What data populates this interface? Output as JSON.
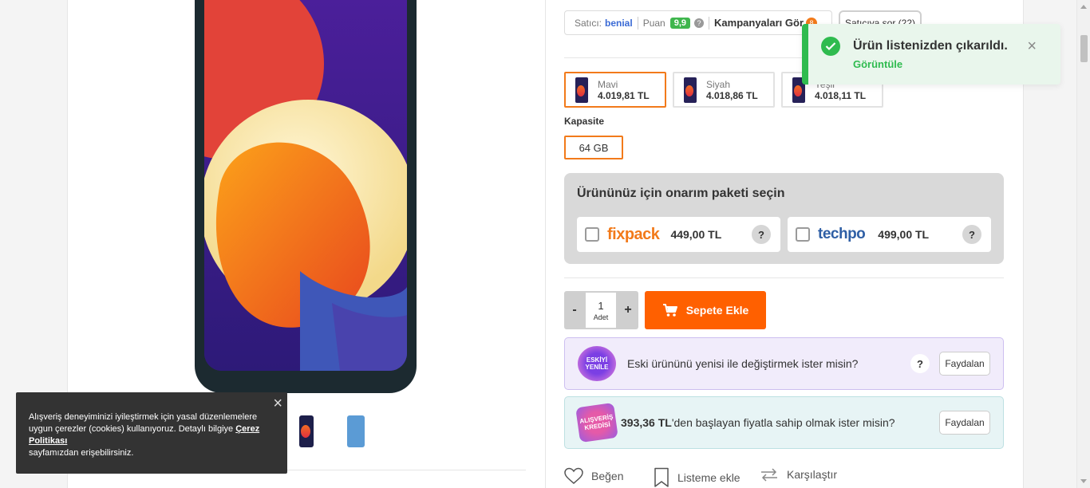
{
  "seller": {
    "label": "Satıcı:",
    "name": "benial",
    "score_label": "Puan",
    "score": "9,9",
    "score_help": "?",
    "campaigns": "Kampanyaları Gör",
    "campaign_count": "8",
    "ask_seller": "Satıcıya sor (22)"
  },
  "variants": [
    {
      "name": "Mavi",
      "price": "4.019,81 TL",
      "selected": true
    },
    {
      "name": "Siyah",
      "price": "4.018,86 TL",
      "selected": false
    },
    {
      "name": "Yeşil",
      "price": "4.018,11 TL",
      "selected": false
    }
  ],
  "capacity": {
    "label": "Kapasite",
    "option": "64 GB"
  },
  "repair": {
    "title": "Ürününüz için onarım paketi seçin",
    "packages": [
      {
        "brand": "fixpack",
        "price": "449,00 TL",
        "help": "?"
      },
      {
        "brand": "techpo",
        "price": "499,00 TL",
        "help": "?"
      }
    ]
  },
  "quantity": {
    "minus": "-",
    "value": "1",
    "unit": "Adet",
    "plus": "+"
  },
  "add_to_cart": "Sepete Ekle",
  "trade_in": {
    "logo": "ESKİYİ YENİLE",
    "text": "Eski ürününü yenisi ile değiştirmek ister misin?",
    "help": "?",
    "button": "Faydalan"
  },
  "credit": {
    "logo": "ALIŞVERİŞ KREDİSİ",
    "amount": "393,36 TL",
    "text": "'den başlayan fiyatla sahip olmak ister misin?",
    "button": "Faydalan"
  },
  "actions": {
    "like": "Beğen",
    "add_list": "Listeme ekle",
    "compare": "Karşılaştır"
  },
  "toast": {
    "title": "Ürün listenizden çıkarıldı.",
    "link": "Görüntüle",
    "close": "×"
  },
  "cookie": {
    "close": "×",
    "text": "Alışveriş deneyiminizi iyileştirmek için yasal düzenlemelere uygun çerezler (cookies) kullanıyoruz. Detaylı bilgiye ",
    "link": "Çerez Politikası",
    "text_after": "sayfamızdan erişebilirsiniz."
  },
  "colors": {
    "brand_orange": "#f27a1a",
    "cart_orange": "#ff6000",
    "success_green": "#2fbb4f",
    "seller_blue": "#3a6ad5"
  }
}
